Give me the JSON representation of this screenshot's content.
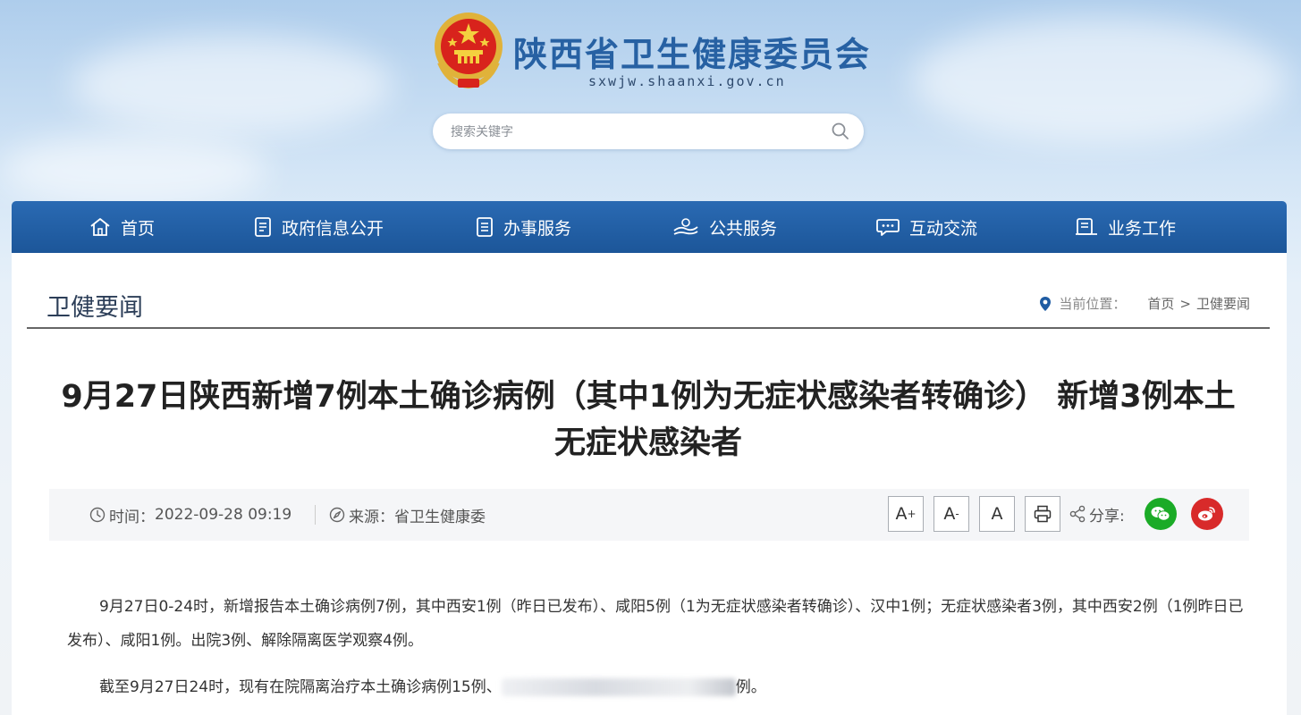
{
  "header": {
    "site_title": "陕西省卫生健康委员会",
    "site_domain": "sxwjw.shaanxi.gov.cn",
    "emblem_icon": "national-emblem-icon"
  },
  "search": {
    "placeholder": "搜索关键字",
    "value": "",
    "icon": "search-icon"
  },
  "nav": {
    "items": [
      {
        "label": "首页",
        "icon": "home-icon"
      },
      {
        "label": "政府信息公开",
        "icon": "document-icon"
      },
      {
        "label": "办事服务",
        "icon": "list-icon"
      },
      {
        "label": "公共服务",
        "icon": "hands-icon"
      },
      {
        "label": "互动交流",
        "icon": "chat-icon"
      },
      {
        "label": "业务工作",
        "icon": "briefcase-icon"
      }
    ]
  },
  "section": {
    "title": "卫健要闻"
  },
  "breadcrumb": {
    "prefix": "当前位置：",
    "home": "首页",
    "separator": ">",
    "current": "卫健要闻"
  },
  "article": {
    "title": "9月27日陕西新增7例本土确诊病例（其中1例为无症状感染者转确诊） 新增3例本土无症状感染者",
    "time_label": "时间：",
    "time_value": "2022-09-28 09:19",
    "source_label": "来源：",
    "source_value": "省卫生健康委",
    "paragraphs": [
      "9月27日0-24时，新增报告本土确诊病例7例，其中西安1例（昨日已发布）、咸阳5例（1为无症状感染者转确诊）、汉中1例；无症状感染者3例，其中西安2例（1例昨日已发布）、咸阳1例。出院3例、解除隔离医学观察4例。",
      "截至9月27日24时，现有在院隔离治疗本土确诊病例15例、"
    ],
    "paragraph2_tail": "例。"
  },
  "toolbar": {
    "font_increase": "A",
    "font_increase_sup": "+",
    "font_decrease": "A",
    "font_decrease_sup": "-",
    "font_default": "A",
    "print_icon": "printer-icon",
    "share_label": "分享:",
    "share_icon": "share-icon",
    "wechat_icon": "wechat-icon",
    "weibo_icon": "weibo-icon"
  },
  "colors": {
    "nav_blue": "#1f5ca3",
    "title_blue": "#2761a3",
    "wechat_green": "#1bab27",
    "weibo_red": "#d82a2a"
  }
}
